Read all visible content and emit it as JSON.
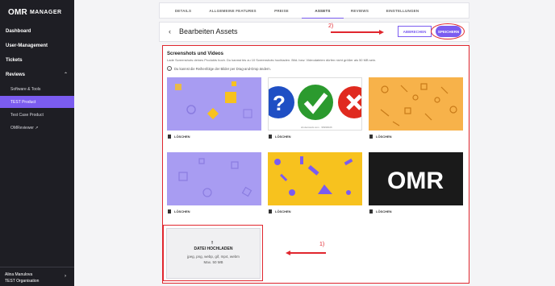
{
  "sidebar": {
    "logo_brand": "OMR",
    "logo_product": "MANAGER",
    "items": {
      "dashboard": "Dashboard",
      "user_management": "User-Management",
      "tickets": "Tickets",
      "reviews": "Reviews",
      "software_tools": "Software & Tools",
      "test_product": "TEST Product",
      "test_case_product": "Test Case Product",
      "omreviewer": "OMReviewer ↗"
    },
    "user": {
      "name": "Alina Manulova",
      "org": "TEST Organisation"
    }
  },
  "tabs": [
    "DETAILS",
    "ALLGEMEINE FEATURES",
    "PREISE",
    "ASSETS",
    "REVIEWS",
    "EINSTELLUNGEN"
  ],
  "active_tab": "ASSETS",
  "header": {
    "back_icon": "‹",
    "title": "Bearbeiten Assets",
    "cancel_label": "ABBRECHEN",
    "save_label": "SPEICHERN"
  },
  "annotations": {
    "step1": "1)",
    "step2": "2)"
  },
  "section": {
    "title": "Screenshots und Videos",
    "description": "Lade Screenshots deines Produkts hoch. Du kannst bis zu 10 Screenshots hochladen. Bild- bzw. Videodateien dürfen nicht größer als 50 MB sein.",
    "info": "Du kannst die Reihenfolge der Bilder per Drag-and-Drop ändern."
  },
  "assets": [
    {
      "delete_label": "LÖSCHEN",
      "style": "purple-yellow"
    },
    {
      "delete_label": "LÖSCHEN",
      "style": "check-marks",
      "caption": "shutterstock.com · 96999026"
    },
    {
      "delete_label": "LÖSCHEN",
      "style": "orange-pattern"
    },
    {
      "delete_label": "LÖSCHEN",
      "style": "purple-squares"
    },
    {
      "delete_label": "LÖSCHEN",
      "style": "yellow-purple"
    },
    {
      "delete_label": "LÖSCHEN",
      "style": "omr-logo",
      "logo_text": "OMR"
    }
  ],
  "upload": {
    "icon": "⭱",
    "title": "DATEI HOCHLADEN",
    "formats": "jpeg, png, webp, gif, mp4, webm",
    "max": "Max. 50 MB"
  },
  "colors": {
    "accent": "#7b5cf0",
    "annotation": "#e0262e",
    "sidebar": "#1e1e24"
  }
}
